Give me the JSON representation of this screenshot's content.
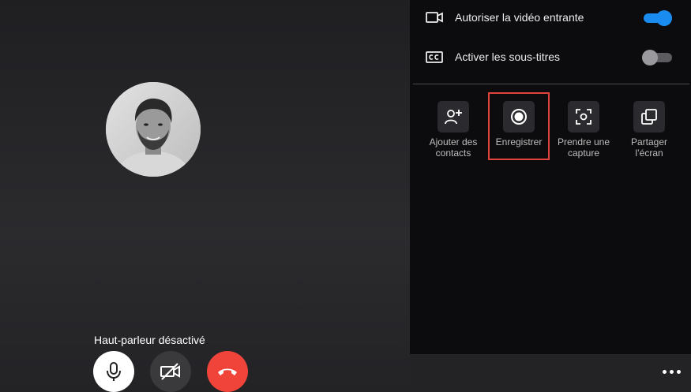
{
  "call": {
    "status_text": "Haut-parleur désactivé",
    "controls": [
      {
        "name": "microphone",
        "icon": "microphone-icon"
      },
      {
        "name": "video-off",
        "icon": "video-off-icon"
      },
      {
        "name": "hang-up",
        "icon": "phone-hangup-icon"
      }
    ]
  },
  "panel": {
    "toggles": [
      {
        "label": "Autoriser la vidéo entrante",
        "icon": "video-camera-icon",
        "enabled": true
      },
      {
        "label": "Activer les sous-titres",
        "icon": "closed-captions-icon",
        "enabled": false
      }
    ],
    "actions": [
      {
        "label": "Ajouter des contacts",
        "icon": "add-person-icon"
      },
      {
        "label": "Enregistrer",
        "icon": "record-icon",
        "highlighted": true
      },
      {
        "label": "Prendre une capture",
        "icon": "screenshot-icon"
      },
      {
        "label": "Partager l’écran",
        "icon": "share-screen-icon"
      }
    ]
  },
  "colors": {
    "accent": "#1a8cf0",
    "hangup": "#f0433a",
    "highlight": "#e0443e",
    "panel_bg": "#0c0c0e"
  }
}
